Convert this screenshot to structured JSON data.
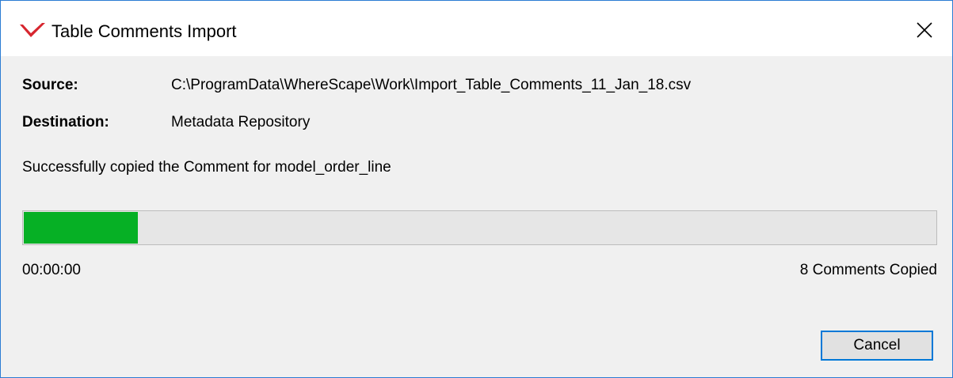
{
  "window": {
    "title": "Table Comments Import",
    "app_icon": "wherescape-logo-icon",
    "close_icon": "close-icon"
  },
  "fields": {
    "source_label": "Source:",
    "source_value": "C:\\ProgramData\\WhereScape\\Work\\Import_Table_Comments_11_Jan_18.csv",
    "destination_label": "Destination:",
    "destination_value": "Metadata Repository"
  },
  "status_message": "Successfully copied the Comment for model_order_line",
  "progress": {
    "fraction": 0.125,
    "color": "#06b025",
    "elapsed": "00:00:00",
    "count_text": "8 Comments Copied"
  },
  "buttons": {
    "cancel_label": "Cancel"
  },
  "colors": {
    "accent": "#0078d7",
    "window_border": "#2b7cd3",
    "logo_red": "#d7262f"
  }
}
